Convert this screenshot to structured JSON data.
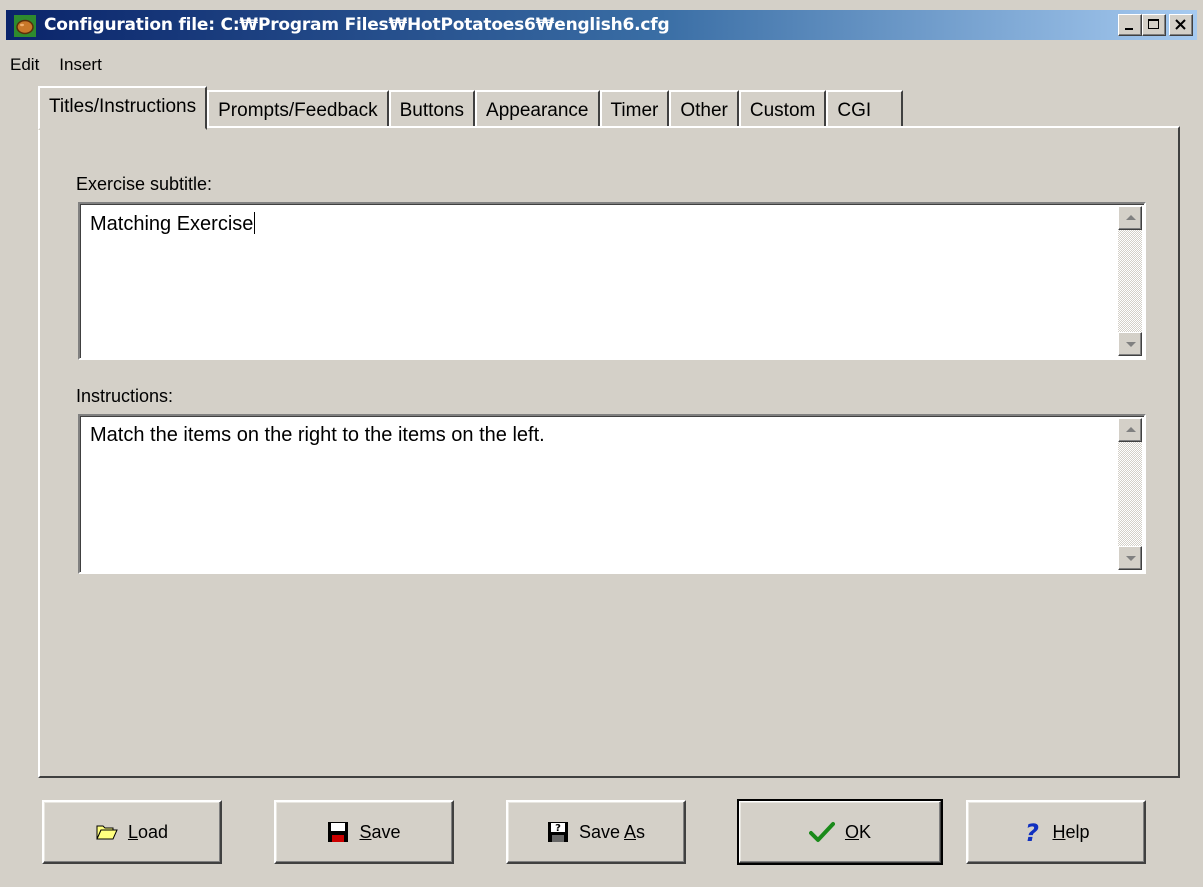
{
  "window": {
    "title": "Configuration file: C:₩Program Files₩HotPotatoes6₩english6.cfg",
    "icon": "hot-potato-icon"
  },
  "menu": {
    "items": [
      "Edit",
      "Insert"
    ]
  },
  "tabs": [
    {
      "label": "Titles/Instructions",
      "active": true
    },
    {
      "label": "Prompts/Feedback",
      "active": false
    },
    {
      "label": "Buttons",
      "active": false
    },
    {
      "label": "Appearance",
      "active": false
    },
    {
      "label": "Timer",
      "active": false
    },
    {
      "label": "Other",
      "active": false
    },
    {
      "label": "Custom",
      "active": false
    },
    {
      "label": "CGI",
      "active": false
    }
  ],
  "fields": {
    "subtitle": {
      "label": "Exercise subtitle:",
      "value": "Matching Exercise"
    },
    "instructions": {
      "label": "Instructions:",
      "value": "Match the items on the right to the items on the left."
    }
  },
  "buttons": {
    "load": {
      "accel": "L",
      "rest": "oad",
      "icon": "folder-open-icon"
    },
    "save": {
      "accel": "S",
      "rest": "ave",
      "icon": "floppy-disk-icon"
    },
    "save_as": {
      "pre": "Save ",
      "accel": "A",
      "rest": "s",
      "icon": "floppy-disk-question-icon"
    },
    "ok": {
      "accel": "O",
      "rest": "K",
      "icon": "checkmark-icon"
    },
    "help": {
      "accel": "H",
      "rest": "elp",
      "icon": "question-mark-icon"
    }
  }
}
